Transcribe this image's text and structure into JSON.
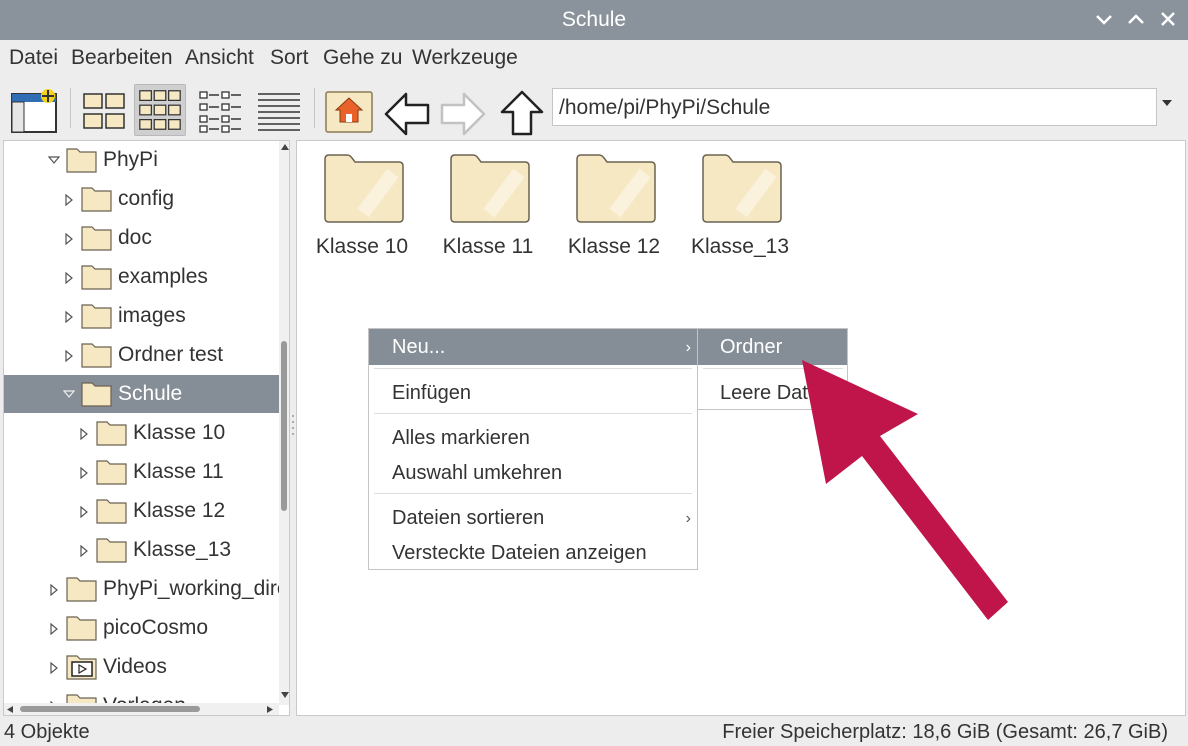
{
  "window": {
    "title": "Schule"
  },
  "menubar": [
    "Datei",
    "Bearbeiten",
    "Ansicht",
    "Sort",
    "Gehe zu",
    "Werkzeuge"
  ],
  "toolbar": {
    "path": "/home/pi/PhyPi/Schule"
  },
  "tree": {
    "items": [
      {
        "label": "PhyPi",
        "expanded": true,
        "icon": "folder-icon"
      },
      {
        "label": "config",
        "icon": "folder-icon"
      },
      {
        "label": "doc",
        "icon": "folder-icon"
      },
      {
        "label": "examples",
        "icon": "folder-icon"
      },
      {
        "label": "images",
        "icon": "folder-icon"
      },
      {
        "label": "Ordner test",
        "icon": "folder-icon"
      },
      {
        "label": "Schule",
        "expanded": true,
        "selected": true,
        "icon": "folder-icon"
      },
      {
        "label": "Klasse 10",
        "icon": "folder-icon"
      },
      {
        "label": "Klasse 11",
        "icon": "folder-icon"
      },
      {
        "label": "Klasse 12",
        "icon": "folder-icon"
      },
      {
        "label": "Klasse_13",
        "icon": "folder-icon"
      },
      {
        "label": "PhyPi_working_dire",
        "icon": "folder-icon"
      },
      {
        "label": "picoCosmo",
        "icon": "folder-icon"
      },
      {
        "label": "Videos",
        "icon": "video-folder-icon"
      },
      {
        "label": "Vorlagen",
        "icon": "folder-icon"
      }
    ]
  },
  "files": [
    {
      "label": "Klasse 10",
      "icon": "folder-icon"
    },
    {
      "label": "Klasse 11",
      "icon": "folder-icon"
    },
    {
      "label": "Klasse 12",
      "icon": "folder-icon"
    },
    {
      "label": "Klasse_13",
      "icon": "folder-icon"
    }
  ],
  "context_menu": {
    "new_label": "Neu...",
    "paste_label": "Einfügen",
    "select_all_label": "Alles markieren",
    "invert_label": "Auswahl umkehren",
    "sort_label": "Dateien sortieren",
    "hidden_label": "Versteckte Dateien anzeigen"
  },
  "submenu": {
    "folder_label": "Ordner",
    "empty_file_label": "Leere Datei"
  },
  "status": {
    "count": "4 Objekte",
    "free_space": "Freier Speicherplatz: 18,6 GiB (Gesamt: 26,7 GiB)"
  },
  "colors": {
    "titlebar": "#8a939b",
    "selection": "#858e96",
    "arrow": "#c0154a",
    "folder_fill": "#f5e8c2",
    "folder_stroke": "#6b6252"
  }
}
